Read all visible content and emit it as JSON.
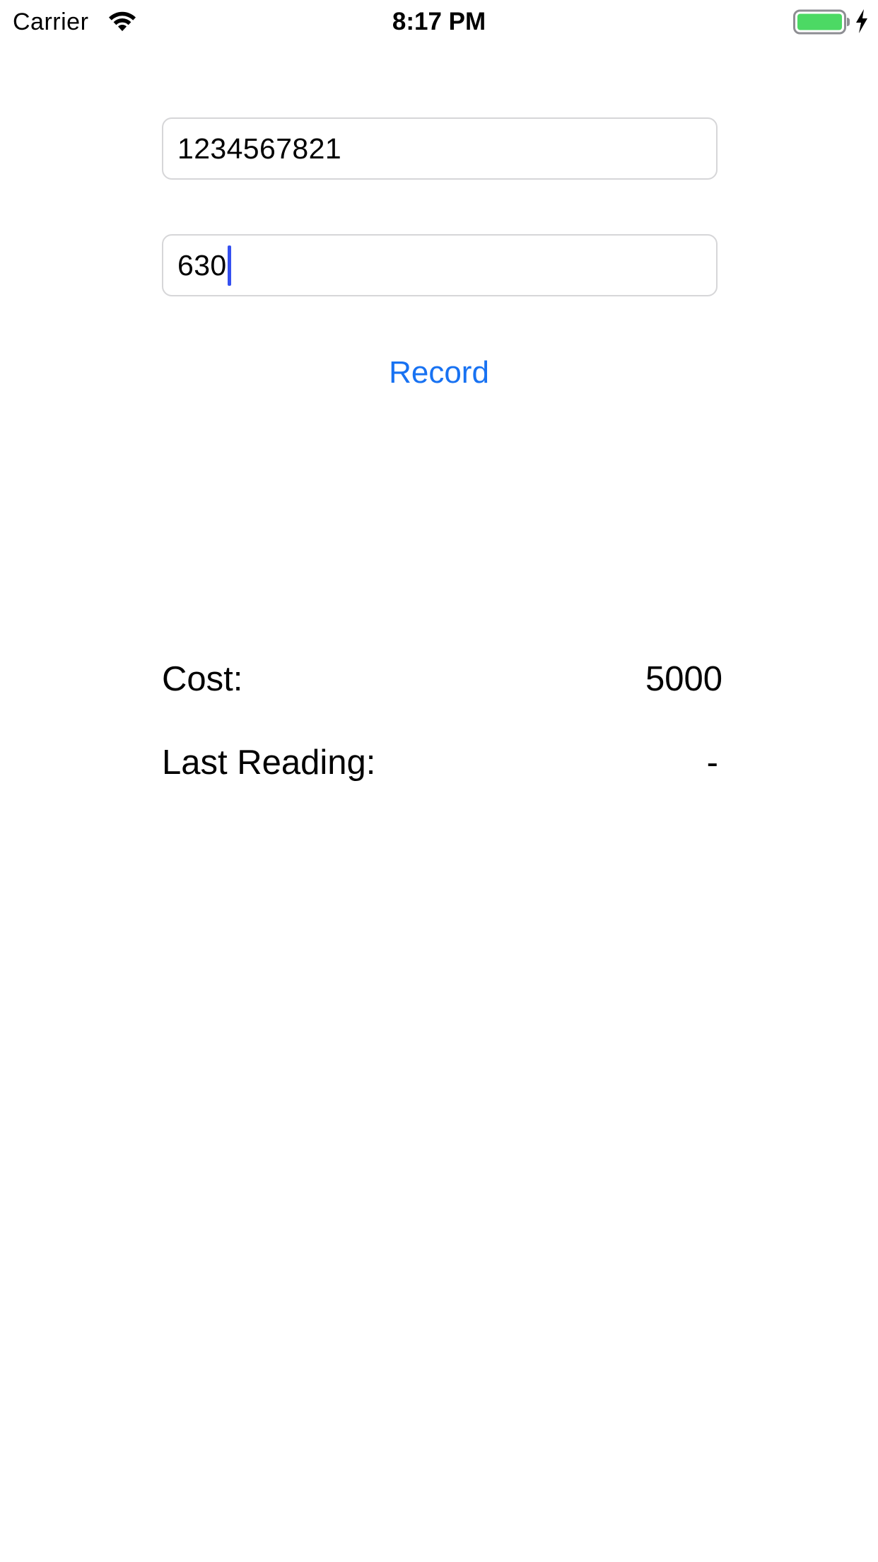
{
  "status_bar": {
    "carrier": "Carrier",
    "time": "8:17 PM",
    "battery_color": "#4cd964"
  },
  "form": {
    "field_1": {
      "value": "1234567821"
    },
    "field_2": {
      "value": "630"
    },
    "record_label": "Record",
    "accent_color": "#1872f2"
  },
  "info": {
    "cost_label": "Cost:",
    "cost_value": "5000",
    "last_reading_label": "Last Reading:",
    "last_reading_value": "-"
  }
}
